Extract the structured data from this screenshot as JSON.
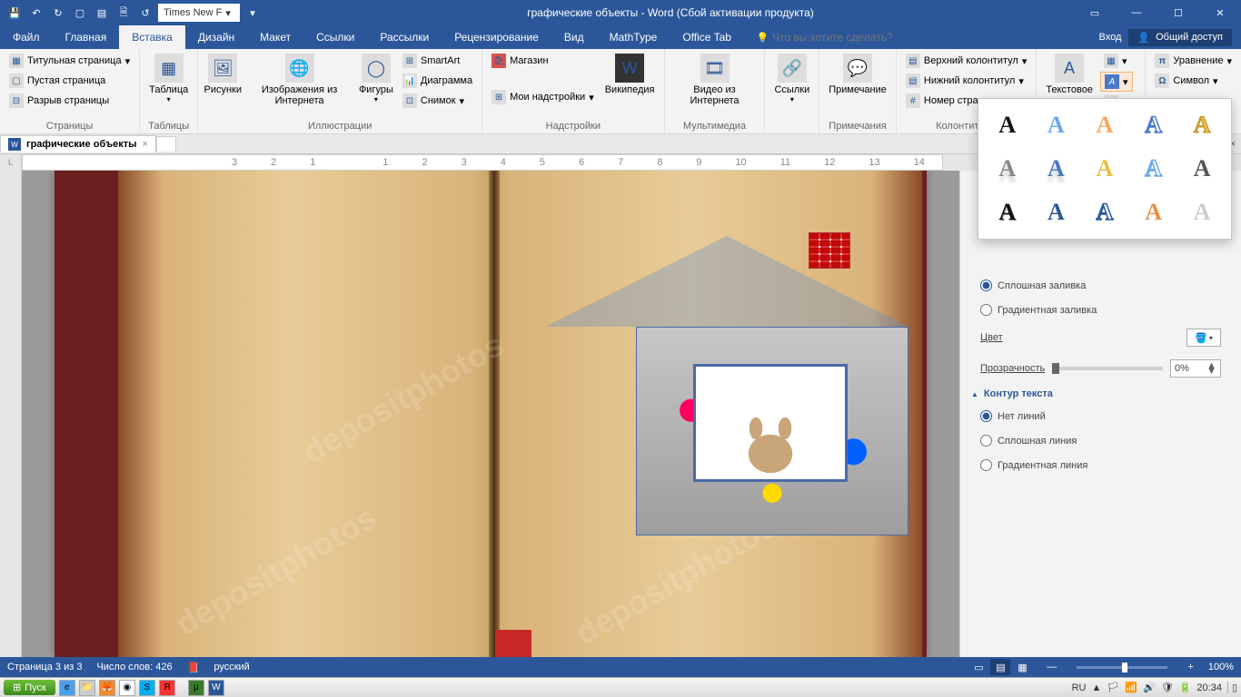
{
  "app": {
    "title": "графические объекты - Word (Сбой активации продукта)",
    "font_name": "Times New F"
  },
  "tabs": {
    "file": "Файл",
    "home": "Главная",
    "insert": "Вставка",
    "design": "Дизайн",
    "layout": "Макет",
    "references": "Ссылки",
    "mailings": "Рассылки",
    "review": "Рецензирование",
    "view": "Вид",
    "mathtype": "MathType",
    "officetab": "Office Tab",
    "tell_me_placeholder": "Что вы хотите сделать?",
    "signin": "Вход",
    "share": "Общий доступ"
  },
  "ribbon": {
    "pages": {
      "title_page": "Титульная страница",
      "blank_page": "Пустая страница",
      "page_break": "Разрыв страницы",
      "group": "Страницы"
    },
    "tables": {
      "table": "Таблица",
      "group": "Таблицы"
    },
    "illus": {
      "pictures": "Рисунки",
      "online_pics": "Изображения из Интернета",
      "shapes": "Фигуры",
      "smartart": "SmartArt",
      "chart": "Диаграмма",
      "screenshot": "Снимок",
      "group": "Иллюстрации"
    },
    "addins": {
      "store": "Магазин",
      "my_addins": "Мои надстройки",
      "wiki": "Википедия",
      "group": "Надстройки"
    },
    "media": {
      "online_video": "Видео из Интернета",
      "group": "Мультимедиа"
    },
    "links": {
      "links": "Ссылки",
      "group": ""
    },
    "comments": {
      "comment": "Примечание",
      "group": "Примечания"
    },
    "hf": {
      "header": "Верхний колонтитул",
      "footer": "Нижний колонтитул",
      "page_num": "Номер страницы",
      "group": "Колонтитулы"
    },
    "text": {
      "textbox": "Текстовое"
    },
    "symbols": {
      "equation": "Уравнение",
      "symbol": "Символ"
    }
  },
  "doctab": {
    "name": "графические объекты"
  },
  "pane": {
    "fill_section": "",
    "solid_fill": "Сплошная заливка",
    "gradient_fill": "Градиентная заливка",
    "color_label": "Цвет",
    "transparency_label": "Прозрачность",
    "transparency_value": "0%",
    "outline_section": "Контур текста",
    "no_line": "Нет линий",
    "solid_line": "Сплошная линия",
    "gradient_line": "Градиентная линия"
  },
  "status": {
    "page_info": "Страница 3 из 3",
    "word_count": "Число слов: 426",
    "language": "русский",
    "zoom_label": "100%"
  },
  "taskbar": {
    "start": "Пуск",
    "lang": "RU",
    "time": "20:34"
  },
  "gallery_letter": "А"
}
